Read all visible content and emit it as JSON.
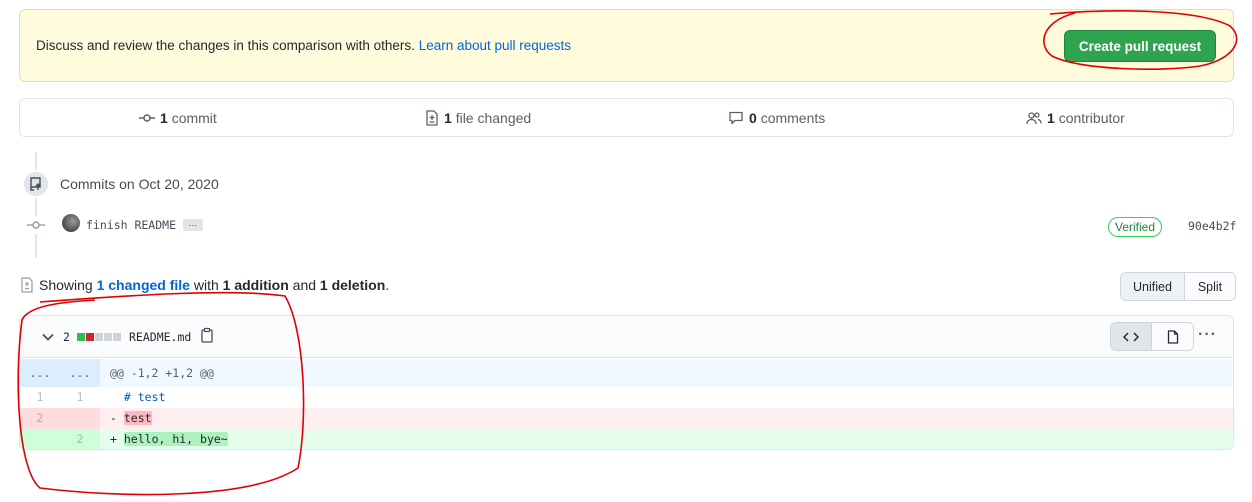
{
  "flash": {
    "message": "Discuss and review the changes in this comparison with others. ",
    "link_text": "Learn about pull requests",
    "create_button": "Create pull request"
  },
  "summary": {
    "commits_count": "1",
    "commits_label": "commit",
    "files_count": "1",
    "files_label": "file changed",
    "comments_count": "0",
    "comments_label": "comments",
    "contributors_count": "1",
    "contributors_label": "contributor"
  },
  "timeline": {
    "heading": "Commits on Oct 20, 2020",
    "commit": {
      "message": "finish README",
      "ellipsis": "…",
      "verified": "Verified",
      "sha": "90e4b2f"
    }
  },
  "showing": {
    "prefix": "Showing ",
    "files_link": "1 changed file",
    "with": " with ",
    "additions": "1 addition",
    "and": " and ",
    "deletions": "1 deletion",
    "suffix": ".",
    "unified": "Unified",
    "split": "Split"
  },
  "file": {
    "changes": "2",
    "name": "README.md",
    "diffstat": [
      "add",
      "del",
      "neutral",
      "neutral",
      "neutral"
    ],
    "hunk": {
      "left": "...",
      "right": "...",
      "header": "@@ -1,2 +1,2 @@"
    },
    "lines": [
      {
        "type": "context",
        "old": "1",
        "new": "1",
        "prefix": " ",
        "text": "# test"
      },
      {
        "type": "deletion",
        "old": "2",
        "new": "",
        "prefix": "-",
        "text": "test"
      },
      {
        "type": "addition",
        "old": "",
        "new": "2",
        "prefix": "+",
        "text": "hello, hi, bye~"
      }
    ]
  },
  "colors": {
    "accent_green": "#2ea44f",
    "link_blue": "#0366d6",
    "annotation_red": "#e00000"
  },
  "icons": [
    "git-commit-icon",
    "file-diff-icon",
    "comment-icon",
    "people-icon",
    "repo-push-icon",
    "chevron-down-icon",
    "clipboard-icon",
    "code-icon",
    "file-icon",
    "kebab-horizontal-icon"
  ]
}
